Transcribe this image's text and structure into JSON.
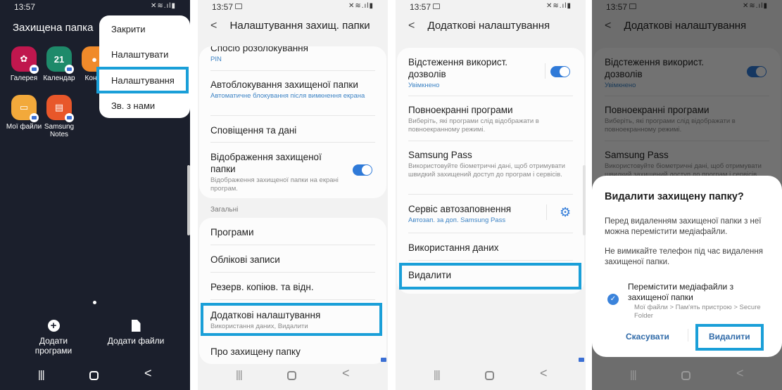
{
  "status_bar": {
    "time": "13:57",
    "icons": "✕≋.ıl▮"
  },
  "panel1": {
    "title": "Захищена папка",
    "apps": [
      {
        "name": "Галерея",
        "icon": "gallery-icon",
        "color": "#c0174e",
        "glyph": "✿"
      },
      {
        "name": "Календар",
        "icon": "calendar-icon",
        "color": "#1e8a6a",
        "glyph": "21"
      },
      {
        "name": "Конта",
        "icon": "contacts-icon",
        "color": "#f08a2a",
        "glyph": "●"
      },
      {
        "name": "Мої файли",
        "icon": "my-files-icon",
        "color": "#f2a93b",
        "glyph": "▭"
      },
      {
        "name": "Samsung Notes",
        "icon": "samsung-notes-icon",
        "color": "#e8572a",
        "glyph": "▤"
      }
    ],
    "menu": [
      "Закрити",
      "Налаштувати",
      "Налаштування",
      "Зв. з нами"
    ],
    "actions": {
      "add_apps": "Додати програми",
      "add_files": "Додати файли"
    }
  },
  "panel2": {
    "title": "Налаштування захищ. папки",
    "back": "<",
    "items": [
      {
        "title": "Спосіб розблокування",
        "sub": "PIN"
      },
      {
        "title": "Автоблокування захищеної папки",
        "sub": "Автоматичне блокування після вимкнення екрана"
      },
      {
        "title": "Сповіщення та дані"
      },
      {
        "title": "Відображення захищеної папки",
        "sub": "Відображення захищеної папки на екрані програм.",
        "toggle": true
      }
    ],
    "section": "Загальні",
    "general": [
      {
        "title": "Програми"
      },
      {
        "title": "Облікові записи"
      },
      {
        "title": "Резерв. копіюв. та відн."
      },
      {
        "title": "Додаткові налаштування",
        "sub": "Використання даних, Видалити"
      },
      {
        "title": "Про захищену папку"
      }
    ]
  },
  "panel3": {
    "title": "Додаткові налаштування",
    "back": "<",
    "items": [
      {
        "title": "Відстеження використ. дозволів",
        "sub": "Увімкнено",
        "toggle": true
      },
      {
        "title": "Повноекранні програми",
        "sub": "Виберіть, які програми слід відображати в повноекранному режимі."
      },
      {
        "title": "Samsung Pass",
        "sub": "Використовуйте біометричні дані, щоб отримувати швидкий захищений доступ до програм і сервісів."
      },
      {
        "title": "Сервіс автозаповнення",
        "sub": "Автозап. за доп. Samsung Pass"
      },
      {
        "title": "Використання даних"
      },
      {
        "title": "Видалити"
      }
    ]
  },
  "panel4": {
    "dialog": {
      "title": "Видалити захищену папку?",
      "text1": "Перед видаленням захищеної папки з неї можна перемістити медіафайли.",
      "text2": "Не вимикайте телефон під час видалення захищеної папки.",
      "checkbox_label": "Перемістити медіафайли з захищеної папки",
      "checkbox_path": "Мої файли > Пам'ять пристрою > Secure Folder",
      "checkbox_checked": true,
      "cancel": "Скасувати",
      "confirm": "Видалити"
    }
  },
  "nav": {
    "recent": "|||",
    "back": "<"
  },
  "accent_colors": {
    "highlight": "#1a9fd8",
    "toggle": "#2f7ad8"
  }
}
